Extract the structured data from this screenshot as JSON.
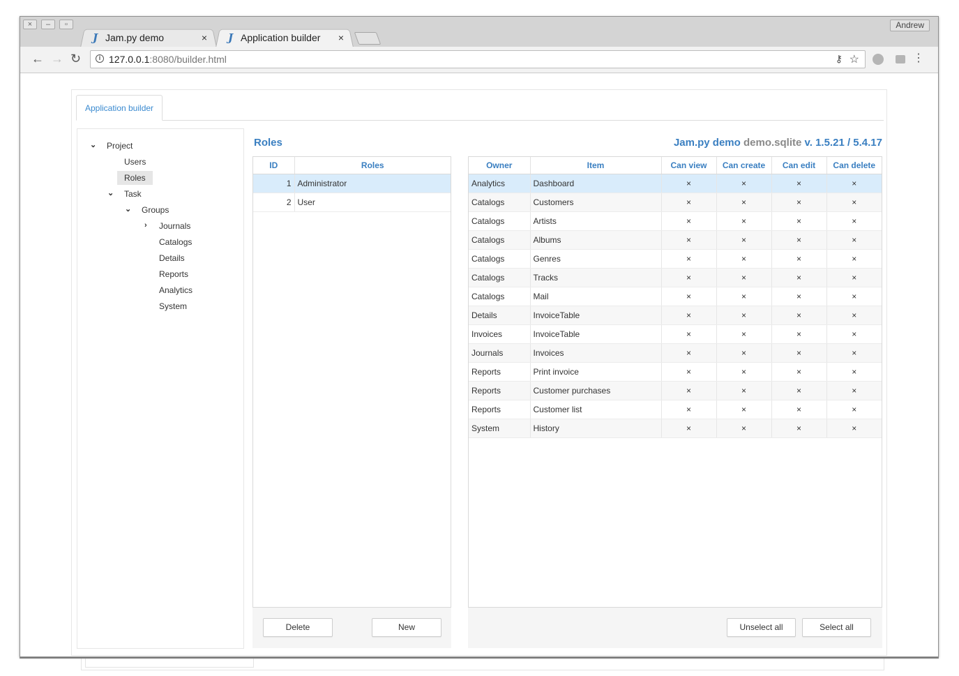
{
  "window": {
    "controls": [
      "close",
      "minimize",
      "maximize"
    ],
    "user": "Andrew"
  },
  "browser": {
    "tabs": [
      {
        "favicon": "J",
        "title": "Jam.py demo",
        "close": "×"
      },
      {
        "favicon": "J",
        "title": "Application builder",
        "close": "×"
      }
    ],
    "url_host": "127.0.0.1",
    "url_rest": ":8080/builder.html",
    "icons": [
      "back-icon",
      "forward-icon",
      "reload-icon",
      "info-icon",
      "key-icon",
      "star-icon",
      "globe-icon",
      "extensions-icon",
      "menu-icon"
    ]
  },
  "app": {
    "tab_label": "Application builder",
    "section_title": "Roles",
    "project_name": "Jam.py demo",
    "db_name": "demo.sqlite",
    "version": "v. 1.5.21 / 5.4.17",
    "tree": [
      {
        "label": "Project",
        "expanded": true
      },
      {
        "label": "Users"
      },
      {
        "label": "Roles",
        "selected": true
      },
      {
        "label": "Task",
        "expanded": true
      },
      {
        "label": "Groups",
        "expanded": true
      },
      {
        "label": "Journals",
        "collapsed": true
      },
      {
        "label": "Catalogs"
      },
      {
        "label": "Details"
      },
      {
        "label": "Reports"
      },
      {
        "label": "Analytics"
      },
      {
        "label": "System"
      }
    ],
    "roles_table": {
      "headers": [
        "ID",
        "Roles"
      ],
      "rows": [
        {
          "id": "1",
          "name": "Administrator",
          "selected": true
        },
        {
          "id": "2",
          "name": "User"
        }
      ]
    },
    "roles_buttons": {
      "delete": "Delete",
      "new": "New"
    },
    "privileges_table": {
      "headers": [
        "Owner",
        "Item",
        "Can view",
        "Can create",
        "Can edit",
        "Can delete"
      ],
      "mark": "×",
      "rows": [
        {
          "owner": "Analytics",
          "item": "Dashboard"
        },
        {
          "owner": "Catalogs",
          "item": "Customers"
        },
        {
          "owner": "Catalogs",
          "item": "Artists"
        },
        {
          "owner": "Catalogs",
          "item": "Albums"
        },
        {
          "owner": "Catalogs",
          "item": "Genres"
        },
        {
          "owner": "Catalogs",
          "item": "Tracks"
        },
        {
          "owner": "Catalogs",
          "item": "Mail"
        },
        {
          "owner": "Details",
          "item": "InvoiceTable"
        },
        {
          "owner": "Invoices",
          "item": "InvoiceTable"
        },
        {
          "owner": "Journals",
          "item": "Invoices"
        },
        {
          "owner": "Reports",
          "item": "Print invoice"
        },
        {
          "owner": "Reports",
          "item": "Customer purchases"
        },
        {
          "owner": "Reports",
          "item": "Customer list"
        },
        {
          "owner": "System",
          "item": "History"
        }
      ]
    },
    "privileges_buttons": {
      "unselect_all": "Unselect all",
      "select_all": "Select all"
    }
  }
}
